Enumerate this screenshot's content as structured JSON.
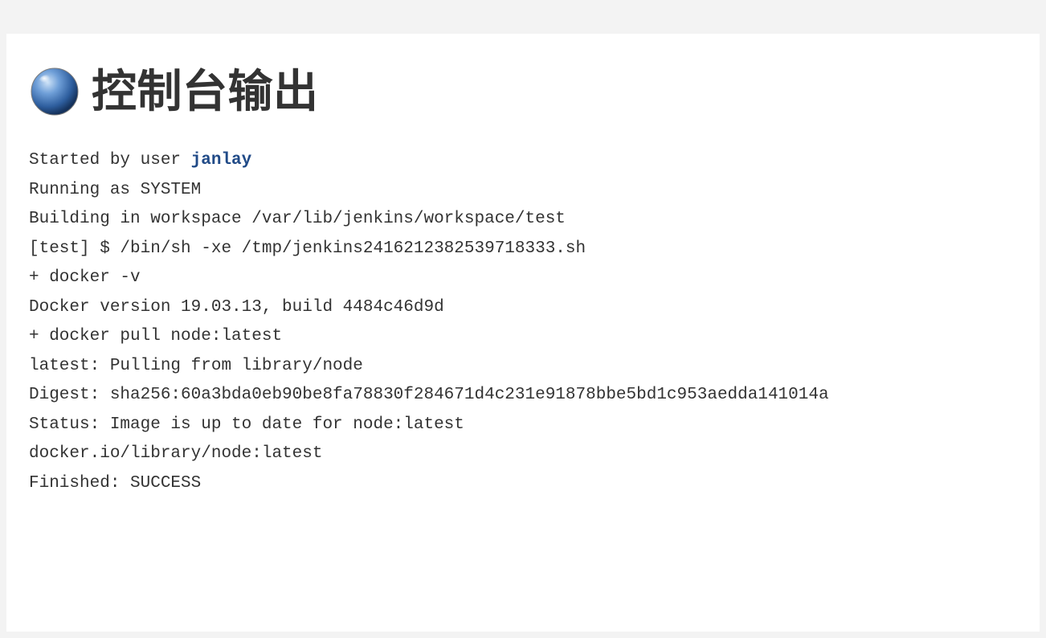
{
  "header": {
    "title": "控制台输出",
    "status_color": "#3b6aa0"
  },
  "console": {
    "started_by_prefix": "Started by user ",
    "user_name": "janlay",
    "lines": [
      "Running as SYSTEM",
      "Building in workspace /var/lib/jenkins/workspace/test",
      "[test] $ /bin/sh -xe /tmp/jenkins2416212382539718333.sh",
      "+ docker -v",
      "Docker version 19.03.13, build 4484c46d9d",
      "+ docker pull node:latest",
      "latest: Pulling from library/node",
      "Digest: sha256:60a3bda0eb90be8fa78830f284671d4c231e91878bbe5bd1c953aedda141014a",
      "Status: Image is up to date for node:latest",
      "docker.io/library/node:latest",
      "Finished: SUCCESS"
    ]
  }
}
